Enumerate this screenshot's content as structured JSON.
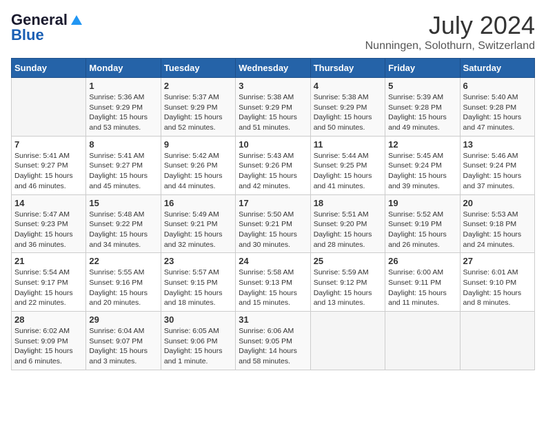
{
  "header": {
    "logo_general": "General",
    "logo_blue": "Blue",
    "month_title": "July 2024",
    "location": "Nunningen, Solothurn, Switzerland"
  },
  "calendar": {
    "days_of_week": [
      "Sunday",
      "Monday",
      "Tuesday",
      "Wednesday",
      "Thursday",
      "Friday",
      "Saturday"
    ],
    "weeks": [
      [
        {
          "day": "",
          "info": ""
        },
        {
          "day": "1",
          "info": "Sunrise: 5:36 AM\nSunset: 9:29 PM\nDaylight: 15 hours\nand 53 minutes."
        },
        {
          "day": "2",
          "info": "Sunrise: 5:37 AM\nSunset: 9:29 PM\nDaylight: 15 hours\nand 52 minutes."
        },
        {
          "day": "3",
          "info": "Sunrise: 5:38 AM\nSunset: 9:29 PM\nDaylight: 15 hours\nand 51 minutes."
        },
        {
          "day": "4",
          "info": "Sunrise: 5:38 AM\nSunset: 9:29 PM\nDaylight: 15 hours\nand 50 minutes."
        },
        {
          "day": "5",
          "info": "Sunrise: 5:39 AM\nSunset: 9:28 PM\nDaylight: 15 hours\nand 49 minutes."
        },
        {
          "day": "6",
          "info": "Sunrise: 5:40 AM\nSunset: 9:28 PM\nDaylight: 15 hours\nand 47 minutes."
        }
      ],
      [
        {
          "day": "7",
          "info": "Sunrise: 5:41 AM\nSunset: 9:27 PM\nDaylight: 15 hours\nand 46 minutes."
        },
        {
          "day": "8",
          "info": "Sunrise: 5:41 AM\nSunset: 9:27 PM\nDaylight: 15 hours\nand 45 minutes."
        },
        {
          "day": "9",
          "info": "Sunrise: 5:42 AM\nSunset: 9:26 PM\nDaylight: 15 hours\nand 44 minutes."
        },
        {
          "day": "10",
          "info": "Sunrise: 5:43 AM\nSunset: 9:26 PM\nDaylight: 15 hours\nand 42 minutes."
        },
        {
          "day": "11",
          "info": "Sunrise: 5:44 AM\nSunset: 9:25 PM\nDaylight: 15 hours\nand 41 minutes."
        },
        {
          "day": "12",
          "info": "Sunrise: 5:45 AM\nSunset: 9:24 PM\nDaylight: 15 hours\nand 39 minutes."
        },
        {
          "day": "13",
          "info": "Sunrise: 5:46 AM\nSunset: 9:24 PM\nDaylight: 15 hours\nand 37 minutes."
        }
      ],
      [
        {
          "day": "14",
          "info": "Sunrise: 5:47 AM\nSunset: 9:23 PM\nDaylight: 15 hours\nand 36 minutes."
        },
        {
          "day": "15",
          "info": "Sunrise: 5:48 AM\nSunset: 9:22 PM\nDaylight: 15 hours\nand 34 minutes."
        },
        {
          "day": "16",
          "info": "Sunrise: 5:49 AM\nSunset: 9:21 PM\nDaylight: 15 hours\nand 32 minutes."
        },
        {
          "day": "17",
          "info": "Sunrise: 5:50 AM\nSunset: 9:21 PM\nDaylight: 15 hours\nand 30 minutes."
        },
        {
          "day": "18",
          "info": "Sunrise: 5:51 AM\nSunset: 9:20 PM\nDaylight: 15 hours\nand 28 minutes."
        },
        {
          "day": "19",
          "info": "Sunrise: 5:52 AM\nSunset: 9:19 PM\nDaylight: 15 hours\nand 26 minutes."
        },
        {
          "day": "20",
          "info": "Sunrise: 5:53 AM\nSunset: 9:18 PM\nDaylight: 15 hours\nand 24 minutes."
        }
      ],
      [
        {
          "day": "21",
          "info": "Sunrise: 5:54 AM\nSunset: 9:17 PM\nDaylight: 15 hours\nand 22 minutes."
        },
        {
          "day": "22",
          "info": "Sunrise: 5:55 AM\nSunset: 9:16 PM\nDaylight: 15 hours\nand 20 minutes."
        },
        {
          "day": "23",
          "info": "Sunrise: 5:57 AM\nSunset: 9:15 PM\nDaylight: 15 hours\nand 18 minutes."
        },
        {
          "day": "24",
          "info": "Sunrise: 5:58 AM\nSunset: 9:13 PM\nDaylight: 15 hours\nand 15 minutes."
        },
        {
          "day": "25",
          "info": "Sunrise: 5:59 AM\nSunset: 9:12 PM\nDaylight: 15 hours\nand 13 minutes."
        },
        {
          "day": "26",
          "info": "Sunrise: 6:00 AM\nSunset: 9:11 PM\nDaylight: 15 hours\nand 11 minutes."
        },
        {
          "day": "27",
          "info": "Sunrise: 6:01 AM\nSunset: 9:10 PM\nDaylight: 15 hours\nand 8 minutes."
        }
      ],
      [
        {
          "day": "28",
          "info": "Sunrise: 6:02 AM\nSunset: 9:09 PM\nDaylight: 15 hours\nand 6 minutes."
        },
        {
          "day": "29",
          "info": "Sunrise: 6:04 AM\nSunset: 9:07 PM\nDaylight: 15 hours\nand 3 minutes."
        },
        {
          "day": "30",
          "info": "Sunrise: 6:05 AM\nSunset: 9:06 PM\nDaylight: 15 hours\nand 1 minute."
        },
        {
          "day": "31",
          "info": "Sunrise: 6:06 AM\nSunset: 9:05 PM\nDaylight: 14 hours\nand 58 minutes."
        },
        {
          "day": "",
          "info": ""
        },
        {
          "day": "",
          "info": ""
        },
        {
          "day": "",
          "info": ""
        }
      ]
    ]
  }
}
